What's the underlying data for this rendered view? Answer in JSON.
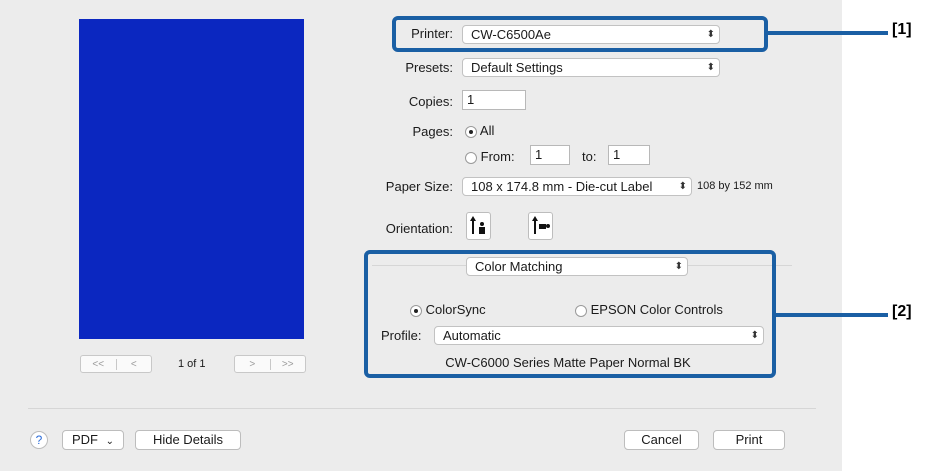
{
  "preview": {
    "page_indicator": "1 of 1",
    "first_glyph": "<<",
    "prev_glyph": "<",
    "next_glyph": ">",
    "last_glyph": ">>"
  },
  "printer": {
    "label": "Printer:",
    "value": "CW-C6500Ae"
  },
  "presets": {
    "label": "Presets:",
    "value": "Default Settings"
  },
  "copies": {
    "label": "Copies:",
    "value": "1"
  },
  "pages": {
    "label": "Pages:",
    "all_label": "All",
    "from_label": "From:",
    "from_value": "1",
    "to_label": "to:",
    "to_value": "1",
    "selected": "All"
  },
  "paper_size": {
    "label": "Paper Size:",
    "value": "108 x 174.8 mm - Die-cut Label",
    "dimensions": "108 by 152 mm"
  },
  "orientation": {
    "label": "Orientation:",
    "options": [
      "portrait",
      "landscape"
    ],
    "selected": "portrait"
  },
  "section_popup": {
    "value": "Color Matching"
  },
  "color_matching": {
    "colorsync_label": "ColorSync",
    "epson_label": "EPSON Color Controls",
    "selected": "ColorSync",
    "profile_label": "Profile:",
    "profile_value": "Automatic",
    "profile_description": "CW-C6000 Series Matte Paper Normal BK"
  },
  "footer": {
    "help": "?",
    "pdf": "PDF",
    "hide_details": "Hide Details",
    "cancel": "Cancel",
    "print": "Print"
  },
  "annotations": {
    "tag1": "[1]",
    "tag2": "[2]",
    "color": "#1a5fa4"
  },
  "icons": {
    "popup_arrows": "⌃⌄",
    "chevron": "⌄"
  }
}
